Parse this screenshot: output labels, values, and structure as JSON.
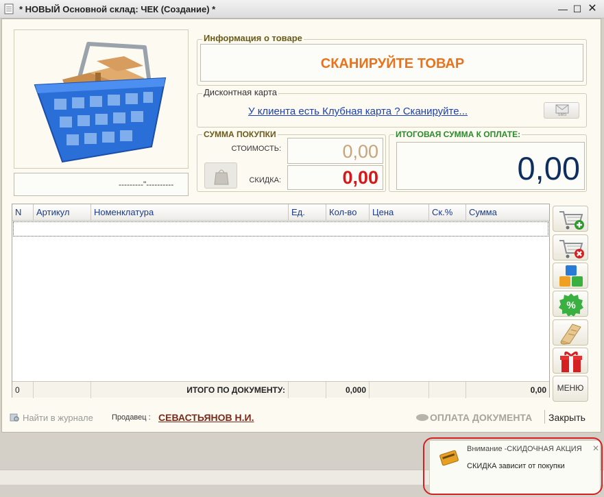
{
  "window": {
    "title": "* НОВЫЙ Основной склад: ЧЕК (Создание) *",
    "min_icon": "minimize-icon",
    "max_icon": "maximize-icon",
    "close_icon": "close-icon"
  },
  "product_info": {
    "group_title": "Информация о товаре",
    "scan_prompt": "СКАНИРУЙТЕ ТОВАР"
  },
  "discount_card": {
    "group_title": "Дисконтная карта",
    "link_text": "У клиента есть Клубная карта ? Сканируйте...",
    "sms_label": "SMS"
  },
  "purchase_sum": {
    "group_title": "СУММА ПОКУПКИ",
    "cost_label": "СТОИМОСТЬ:",
    "cost_value": "0,00",
    "discount_label": "СКИДКА:",
    "discount_value": "0,00"
  },
  "total": {
    "group_title": "ИТОГОВАЯ СУММА К ОПЛАТЕ:",
    "value": "0,00"
  },
  "image_caption": "---------\"----------",
  "table": {
    "columns": [
      "N",
      "Артикул",
      "Номенклатура",
      "Ед.",
      "Кол-во",
      "Цена",
      "Ск.%",
      "Сумма"
    ],
    "footer": {
      "count": "0",
      "total_label": "ИТОГО ПО ДОКУМЕНТУ:",
      "qty_total": "0,000",
      "sum_total": "0,00"
    }
  },
  "side_buttons": {
    "menu_label": "МЕНЮ"
  },
  "bottom": {
    "journal_link": "Найти в журнале",
    "seller_label": "Продавец :",
    "seller_name": "СЕВАСТЬЯНОВ  Н.И.",
    "pay_button": "ОПЛАТА ДОКУМЕНТА",
    "close_button": "Закрыть"
  },
  "notification": {
    "title": "Внимание -СКИДОЧНАЯ АКЦИЯ",
    "text": "СКИДКА зависит от покупки"
  },
  "colors": {
    "scan_prompt": "#e8731c",
    "link": "#1a3fb8",
    "cost_value": "#c8a47a",
    "discount_value": "#d81818",
    "total_value": "#0d2e5e",
    "group_title": "#6b5a1a",
    "total_group_title": "#2a8a2a",
    "seller_name": "#7a2a1a",
    "notification_border": "#d42020"
  }
}
